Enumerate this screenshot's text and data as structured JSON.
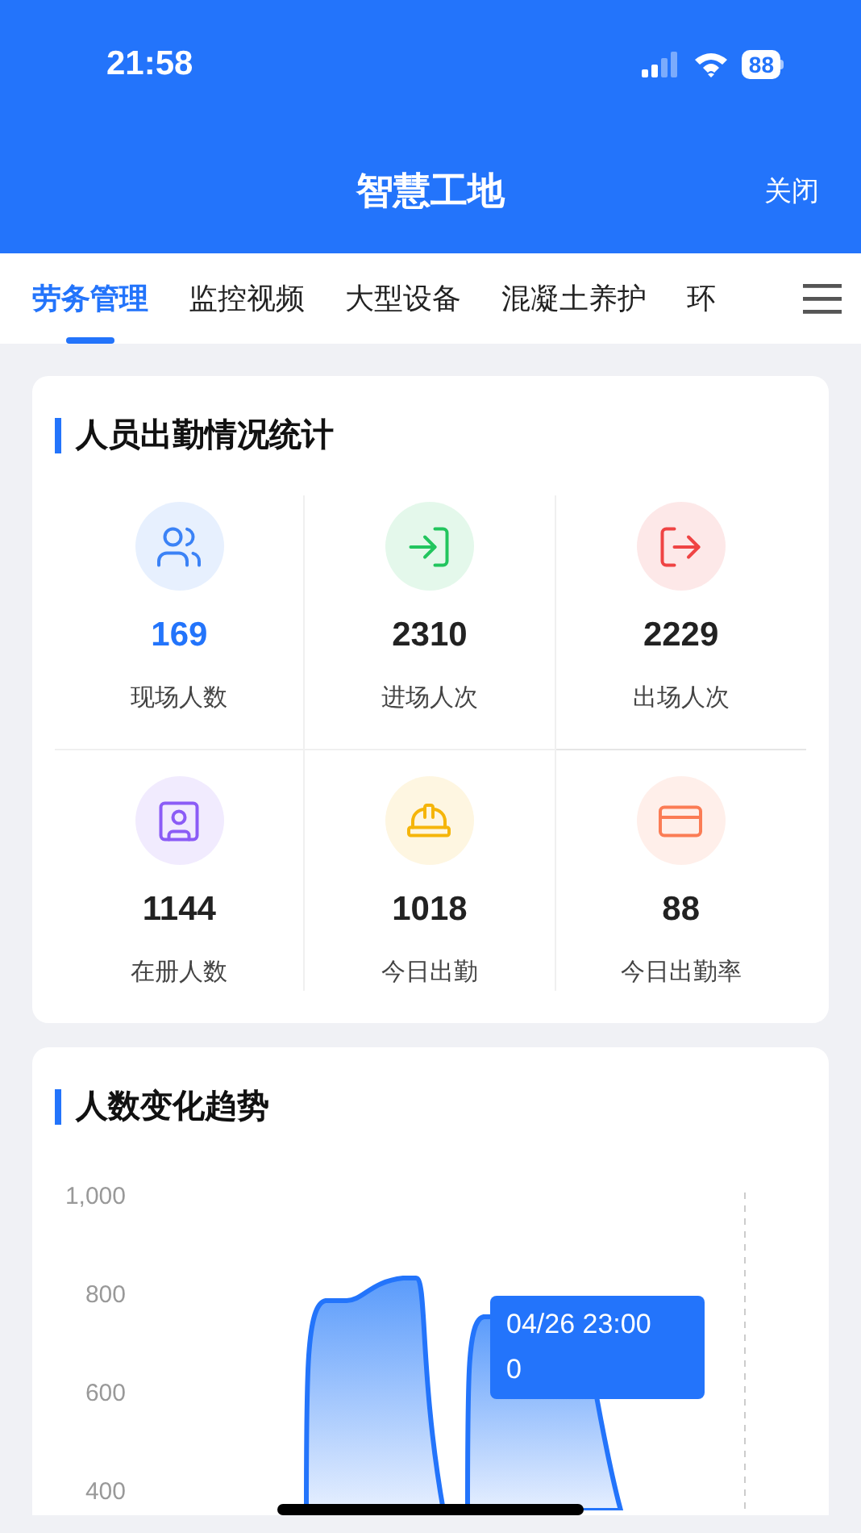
{
  "status_bar": {
    "time": "21:58",
    "battery": "88"
  },
  "header": {
    "title": "智慧工地",
    "close": "关闭"
  },
  "tabs": [
    {
      "label": "劳务管理",
      "selected": true
    },
    {
      "label": "监控视频",
      "selected": false
    },
    {
      "label": "大型设备",
      "selected": false
    },
    {
      "label": "混凝土养护",
      "selected": false
    },
    {
      "label": "环",
      "selected": false
    }
  ],
  "attendance": {
    "title": "人员出勤情况统计",
    "stats": [
      {
        "kind": "people",
        "color": "#3b82f6",
        "value": "169",
        "label": "现场人数",
        "highlight": true
      },
      {
        "kind": "enter",
        "color": "#22c55e",
        "value": "2310",
        "label": "进场人次",
        "highlight": false
      },
      {
        "kind": "exit",
        "color": "#ef4444",
        "value": "2229",
        "label": "出场人次",
        "highlight": false
      },
      {
        "kind": "register",
        "color": "#8b5cf6",
        "value": "1144",
        "label": "在册人数",
        "highlight": false
      },
      {
        "kind": "helmet",
        "color": "#f5b50a",
        "value": "1018",
        "label": "今日出勤",
        "highlight": false
      },
      {
        "kind": "card",
        "color": "#fb7c55",
        "value": "88",
        "label": "今日出勤率",
        "highlight": false
      }
    ]
  },
  "trend": {
    "title": "人数变化趋势",
    "y_labels": [
      "1,000",
      "800",
      "600",
      "400"
    ],
    "tooltip": [
      "04/26 23:00",
      "0"
    ]
  }
}
